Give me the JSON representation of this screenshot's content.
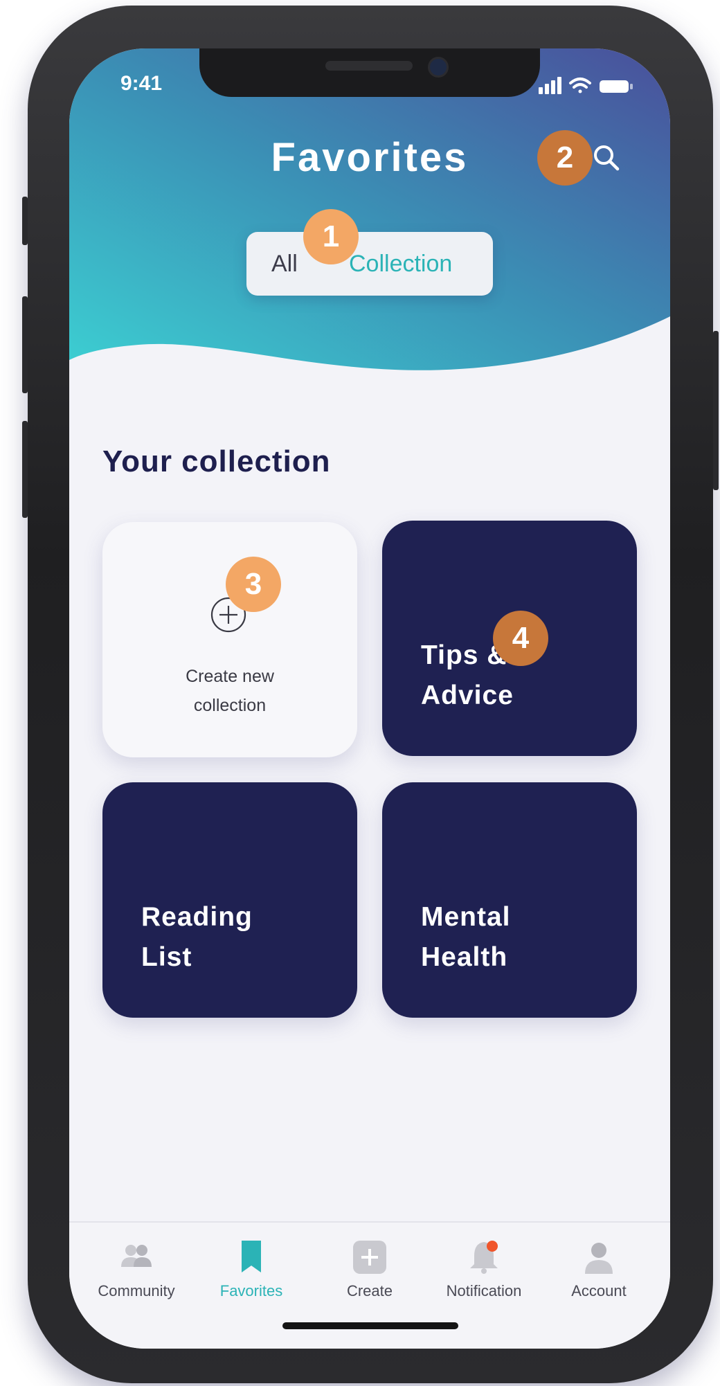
{
  "status_bar": {
    "time": "9:41"
  },
  "header": {
    "title": "Favorites",
    "segment": {
      "all_label": "All",
      "collection_label": "Collection",
      "selected": "Collection"
    }
  },
  "section": {
    "title": "Your collection"
  },
  "cards": {
    "create": {
      "label": "Create new\ncollection"
    },
    "tips": {
      "label": "Tips &\nAdvice"
    },
    "reading": {
      "label": "Reading\nList"
    },
    "mental": {
      "label": "Mental\nHealth"
    }
  },
  "annotations": {
    "b1": "1",
    "b2": "2",
    "b3": "3",
    "b4": "4"
  },
  "tabbar": {
    "community": "Community",
    "favorites": "Favorites",
    "create": "Create",
    "notification": "Notification",
    "account": "Account",
    "active": "Favorites"
  },
  "colors": {
    "accent_teal": "#2bb3b6",
    "navy": "#1f2152",
    "badge_light": "#f3a765",
    "badge_dark": "#c7773a",
    "notification_dot": "#f0552b"
  },
  "icons": {
    "search": "search-icon",
    "create": "plus-circle-icon",
    "community": "people-icon",
    "favorites": "bookmark-icon",
    "create_tab": "plus-square-icon",
    "notification": "bell-icon",
    "account": "user-icon"
  }
}
